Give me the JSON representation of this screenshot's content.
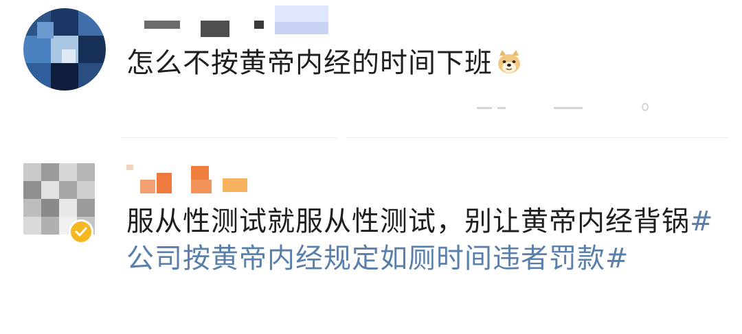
{
  "comments": [
    {
      "username_obscured": true,
      "text": "怎么不按黄帝内经的时间下班",
      "emoji": "doge-emoji"
    },
    {
      "username_obscured": true,
      "text_plain": "服从性测试就服从性测试，别让黄帝内经背锅",
      "hashtag": "#公司按黄帝内经规定如厕时间违者罚款#",
      "verified_badge": "verified-badge-icon"
    }
  ],
  "colors": {
    "hashtag": "#5a7faa",
    "badge": "#f5b722"
  }
}
